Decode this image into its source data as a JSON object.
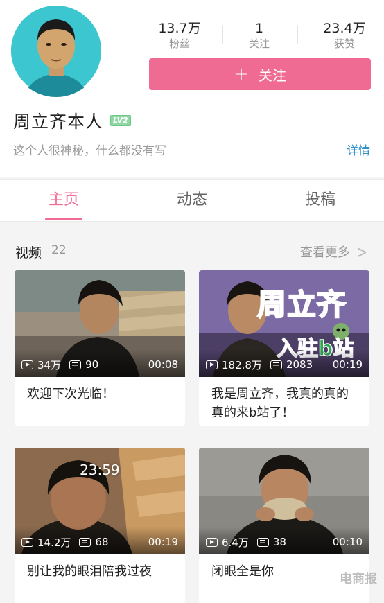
{
  "profile": {
    "username": "周立齐本人",
    "level": "LV2",
    "bio": "这个人很神秘，什么都没有写",
    "detail_label": "详情",
    "follow_label": "关注",
    "stats": [
      {
        "value": "13.7万",
        "label": "粉丝"
      },
      {
        "value": "1",
        "label": "关注"
      },
      {
        "value": "23.4万",
        "label": "获赞"
      }
    ]
  },
  "tabs": [
    {
      "label": "主页",
      "active": true
    },
    {
      "label": "动态",
      "active": false
    },
    {
      "label": "投稿",
      "active": false
    }
  ],
  "videos_section": {
    "title": "视频",
    "count": "22",
    "see_more": "查看更多"
  },
  "videos": [
    {
      "views": "34万",
      "danmaku": "90",
      "duration": "00:08",
      "title": "欢迎下次光临！",
      "overlay_text": ""
    },
    {
      "views": "182.8万",
      "danmaku": "2083",
      "duration": "00:19",
      "title": "我是周立齐，我真的真的真的来b站了！",
      "overlay_text": "周立齐",
      "overlay_text2": "入驻b站"
    },
    {
      "views": "14.2万",
      "danmaku": "68",
      "duration": "00:19",
      "title": "别让我的眼泪陪我过夜",
      "overlay_text": "23:59"
    },
    {
      "views": "6.4万",
      "danmaku": "38",
      "duration": "00:10",
      "title": "闭眼全是你",
      "overlay_text": ""
    }
  ],
  "watermark": "电商报",
  "colors": {
    "accent": "#f06b93",
    "link": "#2e90c9",
    "level_badge": "#8fd7a3"
  }
}
